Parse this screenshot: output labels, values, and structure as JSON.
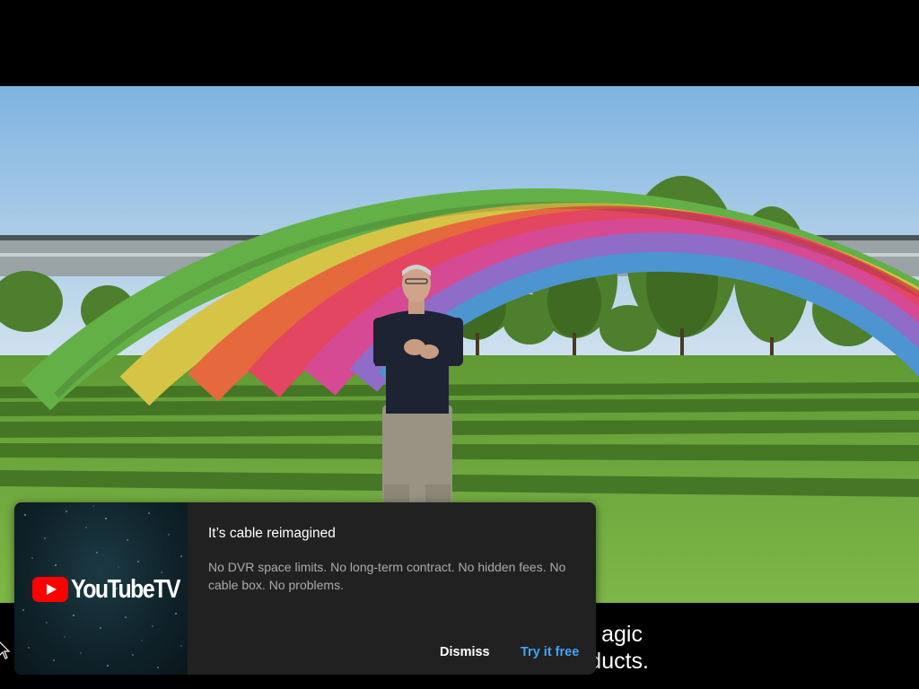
{
  "video": {
    "caption_line_1": "agic",
    "caption_line_2": "ducts."
  },
  "promo": {
    "brand_name": "YouTubeTV",
    "logo_icon": "youtube-play-icon",
    "title": "It’s cable reimagined",
    "body": "No DVR space limits. No long-term contract. No hidden fees. No cable box. No problems.",
    "dismiss_label": "Dismiss",
    "try_label": "Try it free",
    "colors": {
      "background": "#212121",
      "accent": "#3ea6ff",
      "brand_red": "#ff0000"
    }
  }
}
